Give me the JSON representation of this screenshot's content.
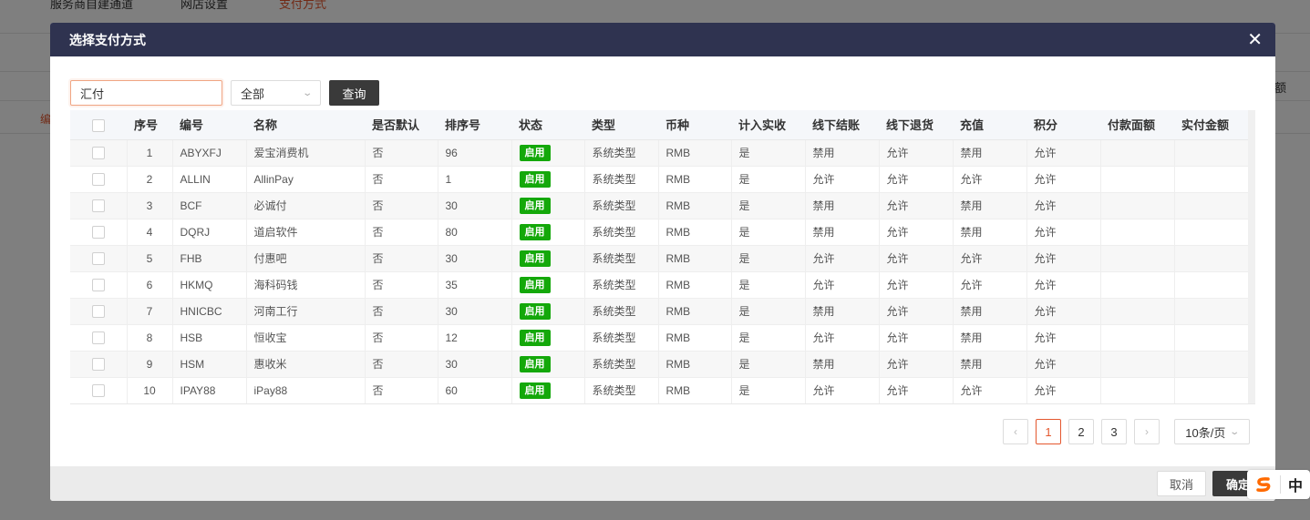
{
  "background": {
    "tabs": [
      "服务商自建通道",
      "网店设置",
      "支付方式"
    ],
    "column_right": "额",
    "row_left": "编"
  },
  "modal": {
    "title": "选择支付方式",
    "close_icon": "close-icon",
    "search": {
      "value": "汇付",
      "placeholder": ""
    },
    "filter": {
      "selected": "全部"
    },
    "query_label": "查询",
    "table": {
      "columns": [
        "序号",
        "编号",
        "名称",
        "是否默认",
        "排序号",
        "状态",
        "类型",
        "币种",
        "计入实收",
        "线下结账",
        "线下退货",
        "充值",
        "积分",
        "付款面额",
        "实付金额"
      ],
      "rows": [
        {
          "no": "1",
          "code": "ABYXFJ",
          "name": "爱宝消费机",
          "default": "否",
          "sort": "96",
          "status": "启用",
          "type": "系统类型",
          "currency": "RMB",
          "count_in": "是",
          "offline_checkout": "禁用",
          "offline_return": "允许",
          "recharge": "禁用",
          "points": "允许",
          "face_value": "",
          "paid_amount": ""
        },
        {
          "no": "2",
          "code": "ALLIN",
          "name": "AllinPay",
          "default": "否",
          "sort": "1",
          "status": "启用",
          "type": "系统类型",
          "currency": "RMB",
          "count_in": "是",
          "offline_checkout": "允许",
          "offline_return": "允许",
          "recharge": "允许",
          "points": "允许",
          "face_value": "",
          "paid_amount": ""
        },
        {
          "no": "3",
          "code": "BCF",
          "name": "必诚付",
          "default": "否",
          "sort": "30",
          "status": "启用",
          "type": "系统类型",
          "currency": "RMB",
          "count_in": "是",
          "offline_checkout": "禁用",
          "offline_return": "允许",
          "recharge": "禁用",
          "points": "允许",
          "face_value": "",
          "paid_amount": ""
        },
        {
          "no": "4",
          "code": "DQRJ",
          "name": "道启软件",
          "default": "否",
          "sort": "80",
          "status": "启用",
          "type": "系统类型",
          "currency": "RMB",
          "count_in": "是",
          "offline_checkout": "禁用",
          "offline_return": "允许",
          "recharge": "禁用",
          "points": "允许",
          "face_value": "",
          "paid_amount": ""
        },
        {
          "no": "5",
          "code": "FHB",
          "name": "付惠吧",
          "default": "否",
          "sort": "30",
          "status": "启用",
          "type": "系统类型",
          "currency": "RMB",
          "count_in": "是",
          "offline_checkout": "允许",
          "offline_return": "允许",
          "recharge": "允许",
          "points": "允许",
          "face_value": "",
          "paid_amount": ""
        },
        {
          "no": "6",
          "code": "HKMQ",
          "name": "海科码钱",
          "default": "否",
          "sort": "35",
          "status": "启用",
          "type": "系统类型",
          "currency": "RMB",
          "count_in": "是",
          "offline_checkout": "允许",
          "offline_return": "允许",
          "recharge": "允许",
          "points": "允许",
          "face_value": "",
          "paid_amount": ""
        },
        {
          "no": "7",
          "code": "HNICBC",
          "name": "河南工行",
          "default": "否",
          "sort": "30",
          "status": "启用",
          "type": "系统类型",
          "currency": "RMB",
          "count_in": "是",
          "offline_checkout": "禁用",
          "offline_return": "允许",
          "recharge": "禁用",
          "points": "允许",
          "face_value": "",
          "paid_amount": ""
        },
        {
          "no": "8",
          "code": "HSB",
          "name": "恒收宝",
          "default": "否",
          "sort": "12",
          "status": "启用",
          "type": "系统类型",
          "currency": "RMB",
          "count_in": "是",
          "offline_checkout": "允许",
          "offline_return": "允许",
          "recharge": "禁用",
          "points": "允许",
          "face_value": "",
          "paid_amount": ""
        },
        {
          "no": "9",
          "code": "HSM",
          "name": "惠收米",
          "default": "否",
          "sort": "30",
          "status": "启用",
          "type": "系统类型",
          "currency": "RMB",
          "count_in": "是",
          "offline_checkout": "禁用",
          "offline_return": "允许",
          "recharge": "禁用",
          "points": "允许",
          "face_value": "",
          "paid_amount": ""
        },
        {
          "no": "10",
          "code": "IPAY88",
          "name": "iPay88",
          "default": "否",
          "sort": "60",
          "status": "启用",
          "type": "系统类型",
          "currency": "RMB",
          "count_in": "是",
          "offline_checkout": "允许",
          "offline_return": "允许",
          "recharge": "允许",
          "points": "允许",
          "face_value": "",
          "paid_amount": ""
        }
      ]
    },
    "pagination": {
      "pages": [
        "1",
        "2",
        "3"
      ],
      "current": "1",
      "prev_icon": "‹",
      "next_icon": "›",
      "page_size": "10条/页"
    },
    "footer": {
      "cancel": "取消",
      "confirm": "确定"
    }
  },
  "ime": {
    "lang": "中"
  },
  "colors": {
    "header_bg": "#2f3350",
    "accent": "#e4572e",
    "status_green": "#14a80a",
    "dark_button": "#3a3a3a"
  }
}
